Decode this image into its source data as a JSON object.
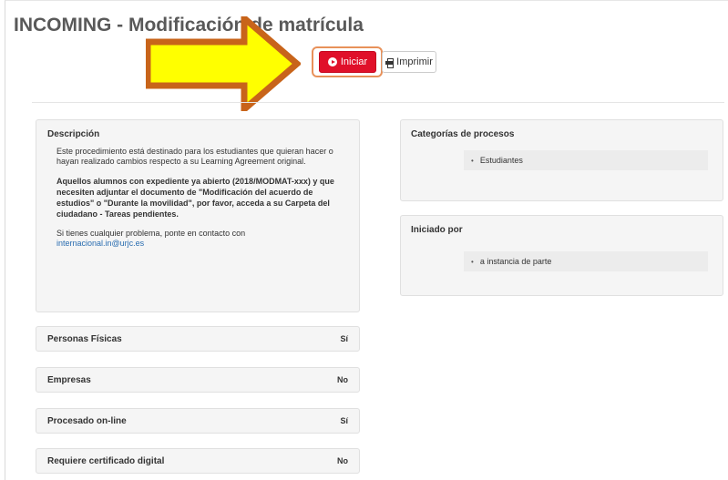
{
  "header": {
    "title": "INCOMING - Modificación de matrícula"
  },
  "actions": {
    "start_label": "Iniciar",
    "print_label": "Imprimir"
  },
  "description": {
    "title": "Descripción",
    "p1": "Este procedimiento está destinado para los estudiantes que quieran hacer o hayan realizado cambios respecto a su Learning Agreement original.",
    "p2": "Aquellos alumnos con expediente ya abierto (2018/MODMAT-xxx) y que necesiten adjuntar el documento de \"Modificación del acuerdo de estudios\" o \"Durante la movilidad\", por favor, acceda a su Carpeta del ciudadano - Tareas pendientes.",
    "p3": "Si tienes cualquier problema, ponte en contacto con",
    "email": "internacional.in@urjc.es"
  },
  "categories": {
    "title": "Categorías de procesos",
    "items": [
      "Estudiantes"
    ]
  },
  "initiated_by": {
    "title": "Iniciado por",
    "items": [
      "a instancia de parte"
    ]
  },
  "properties": [
    {
      "label": "Personas Físicas",
      "value": "Sí"
    },
    {
      "label": "Empresas",
      "value": "No"
    },
    {
      "label": "Procesado on-line",
      "value": "Sí"
    },
    {
      "label": "Requiere certificado digital",
      "value": "No"
    }
  ],
  "colors": {
    "accent": "#e0102a",
    "highlight_arrow": "#ffff00",
    "arrow_border": "#c8641a",
    "link": "#2a6db0"
  }
}
